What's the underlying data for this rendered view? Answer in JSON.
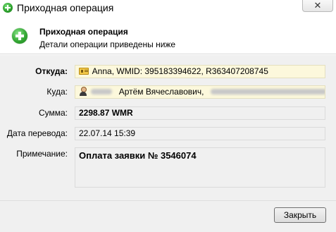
{
  "window": {
    "title": "Приходная операция",
    "close_glyph": "✕"
  },
  "header": {
    "title": "Приходная операция",
    "subtitle": "Детали операции приведены ниже",
    "icon": "add-green-icon"
  },
  "fields": {
    "from": {
      "label": "Откуда:",
      "value": "Anna, WMID: 395183394622, R363407208745",
      "icon": "wmid-card-icon"
    },
    "to": {
      "label": "Куда:",
      "value": "Артём Вячеславович,",
      "icon": "person-icon"
    },
    "amount": {
      "label": "Сумма:",
      "value": "2298.87 WMR"
    },
    "date": {
      "label": "Дата перевода:",
      "value": "22.07.14 15:39"
    },
    "note": {
      "label": "Примечание:",
      "value": "Оплата заявки № 3546074"
    }
  },
  "footer": {
    "close_label": "Закрыть"
  }
}
